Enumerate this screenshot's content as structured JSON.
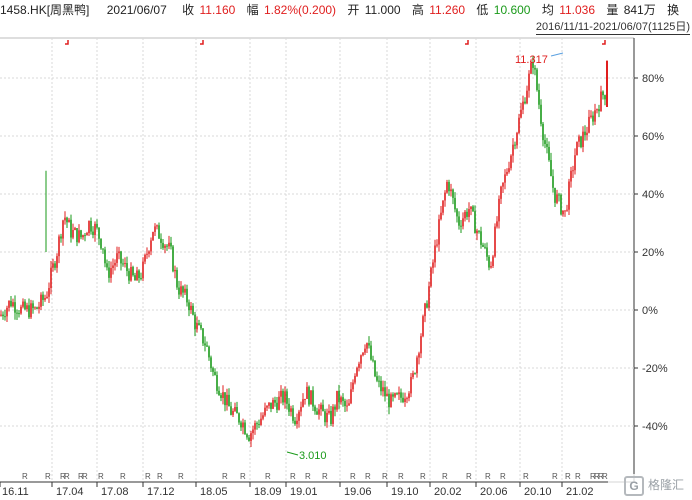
{
  "header": {
    "code": "1458.HK[周黑鸭]",
    "date": "2021/06/07",
    "close_label": "收",
    "close_value": "11.160",
    "change_label": "幅",
    "change_value": "1.82%(0.200)",
    "open_label": "开",
    "open_value": "11.000",
    "high_label": "高",
    "high_value": "11.260",
    "low_label": "低",
    "low_value": "10.600",
    "avg_label": "均",
    "avg_value": "11.036",
    "vol_label": "量",
    "vol_value": "841万",
    "switch_label": "换"
  },
  "range_text": "2016/11/11-2021/06/07(1125日)",
  "markers": {
    "max_label": "11.317",
    "min_label": "3.010"
  },
  "watermark": {
    "glyph": "G",
    "text": "格隆汇"
  },
  "colors": {
    "up": "#e01e1e",
    "down": "#1a9a1a",
    "grid": "#d9d9d9",
    "axis": "#333333"
  },
  "chart_data": {
    "type": "candlestick-line",
    "y_ticks": [
      "80%",
      "60%",
      "40%",
      "20%",
      "0%",
      "-20%",
      "-40%"
    ],
    "y_values": [
      80,
      60,
      40,
      20,
      0,
      -20,
      -40
    ],
    "x_ticks": [
      "16.11",
      "17.04",
      "17.08",
      "17.12",
      "18.05",
      "18.09",
      "19.01",
      "19.06",
      "19.10",
      "20.02",
      "20.06",
      "20.10",
      "21.02"
    ],
    "series": [
      {
        "points": [
          [
            0,
            -2
          ],
          [
            0.3,
            3
          ],
          [
            0.6,
            0
          ],
          [
            1,
            0
          ],
          [
            1.3,
            5
          ],
          [
            1.6,
            20
          ],
          [
            1.8,
            33
          ],
          [
            2,
            27
          ],
          [
            2.3,
            25
          ],
          [
            2.5,
            30
          ],
          [
            2.7,
            28
          ],
          [
            2.9,
            22
          ],
          [
            3,
            12
          ],
          [
            3.3,
            18
          ],
          [
            3.5,
            15
          ],
          [
            3.8,
            10
          ],
          [
            4,
            13
          ],
          [
            4.3,
            28
          ],
          [
            4.5,
            26
          ],
          [
            4.8,
            20
          ],
          [
            5,
            8
          ],
          [
            5.3,
            3
          ],
          [
            5.5,
            -5
          ],
          [
            5.8,
            -12
          ],
          [
            6,
            -22
          ],
          [
            6.3,
            -30
          ],
          [
            6.5,
            -35
          ],
          [
            6.8,
            -38
          ],
          [
            7,
            -43
          ],
          [
            7.3,
            -38
          ],
          [
            7.6,
            -33
          ],
          [
            8,
            -30
          ],
          [
            8.3,
            -37
          ],
          [
            8.6,
            -28
          ],
          [
            9,
            -35
          ],
          [
            9.3,
            -38
          ],
          [
            9.5,
            -30
          ],
          [
            9.8,
            -35
          ],
          [
            10,
            -20
          ],
          [
            10.3,
            -10
          ],
          [
            10.6,
            -25
          ],
          [
            11,
            -32
          ],
          [
            11.3,
            -30
          ],
          [
            11.6,
            -25
          ],
          [
            12,
            2
          ],
          [
            12.3,
            25
          ],
          [
            12.6,
            45
          ],
          [
            12.9,
            30
          ],
          [
            13.2,
            35
          ],
          [
            13.5,
            25
          ],
          [
            13.8,
            15
          ],
          [
            14.1,
            40
          ],
          [
            14.4,
            55
          ],
          [
            14.7,
            70
          ],
          [
            15,
            86
          ],
          [
            15.3,
            60
          ],
          [
            15.6,
            40
          ],
          [
            15.9,
            33
          ],
          [
            16.2,
            55
          ],
          [
            16.5,
            62
          ],
          [
            16.8,
            70
          ],
          [
            17,
            75
          ]
        ]
      }
    ]
  }
}
